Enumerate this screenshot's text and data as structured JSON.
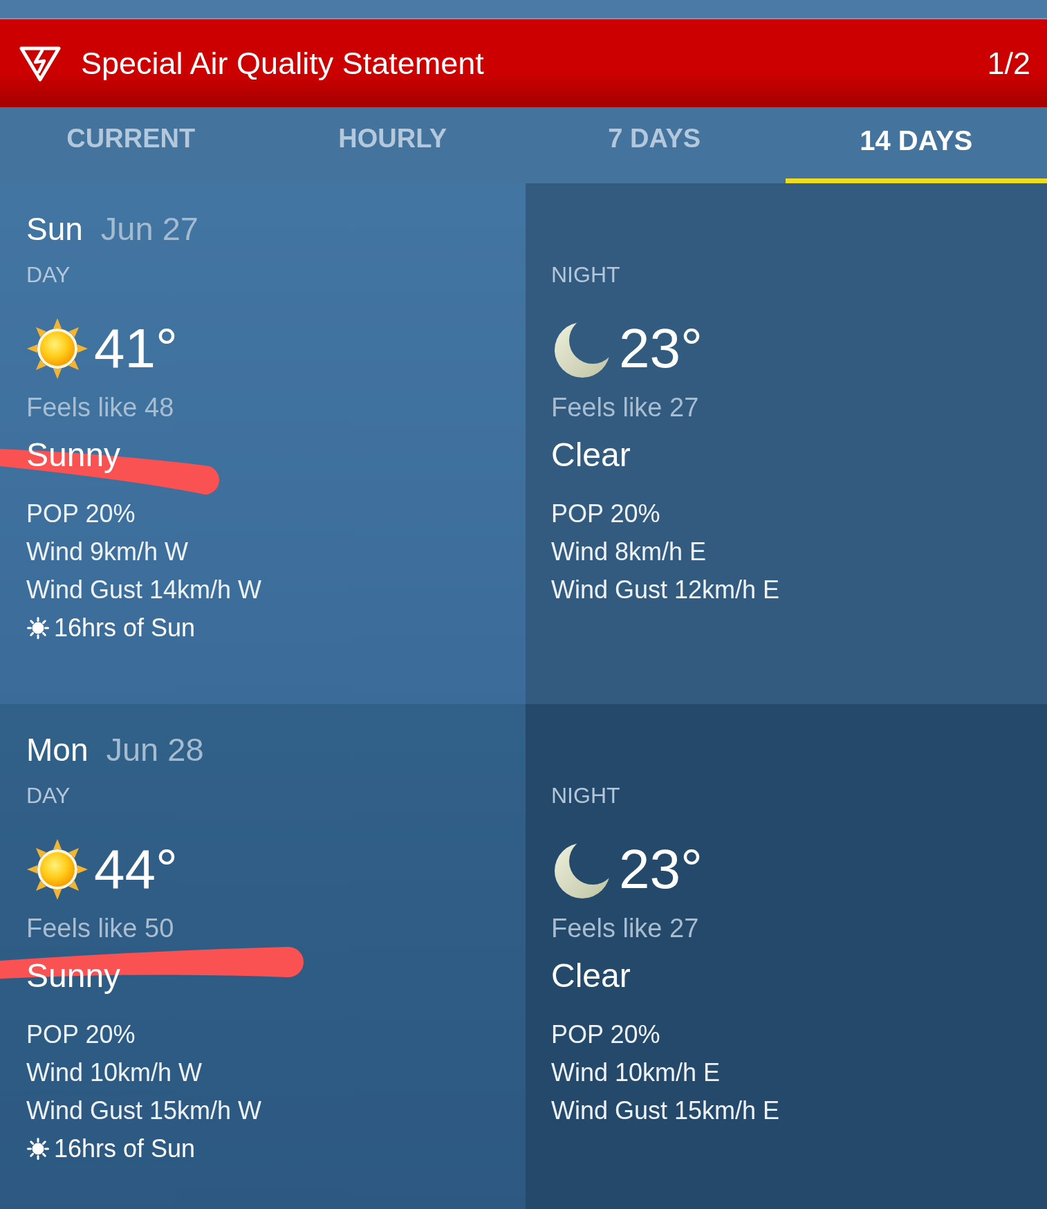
{
  "alert": {
    "title": "Special Air Quality Statement",
    "counter": "1/2"
  },
  "tabs": [
    {
      "label": "CURRENT",
      "selected": false
    },
    {
      "label": "HOURLY",
      "selected": false
    },
    {
      "label": "7 DAYS",
      "selected": false
    },
    {
      "label": "14 DAYS",
      "selected": true
    }
  ],
  "days": [
    {
      "weekday": "Sun",
      "date": "Jun 27",
      "periods": [
        {
          "kind": "day",
          "label": "DAY",
          "temperature": "41°",
          "feels_like": "Feels like 48",
          "condition": "Sunny",
          "marker_stroke": true,
          "details": [
            "POP 20%",
            "Wind 9km/h W",
            "Wind Gust 14km/h W"
          ],
          "sun_hours": "16hrs of Sun"
        },
        {
          "kind": "night",
          "label": "NIGHT",
          "temperature": "23°",
          "feels_like": "Feels like 27",
          "condition": "Clear",
          "marker_stroke": false,
          "details": [
            "POP 20%",
            "Wind 8km/h E",
            "Wind Gust 12km/h E"
          ]
        }
      ]
    },
    {
      "weekday": "Mon",
      "date": "Jun 28",
      "periods": [
        {
          "kind": "day",
          "label": "DAY",
          "temperature": "44°",
          "feels_like": "Feels like 50",
          "condition": "Sunny",
          "marker_stroke": true,
          "details": [
            "POP 20%",
            "Wind 10km/h W",
            "Wind Gust 15km/h W"
          ],
          "sun_hours": "16hrs of Sun"
        },
        {
          "kind": "night",
          "label": "NIGHT",
          "temperature": "23°",
          "feels_like": "Feels like 27",
          "condition": "Clear",
          "marker_stroke": false,
          "details": [
            "POP 20%",
            "Wind 10km/h E",
            "Wind Gust 15km/h E"
          ]
        }
      ]
    }
  ]
}
